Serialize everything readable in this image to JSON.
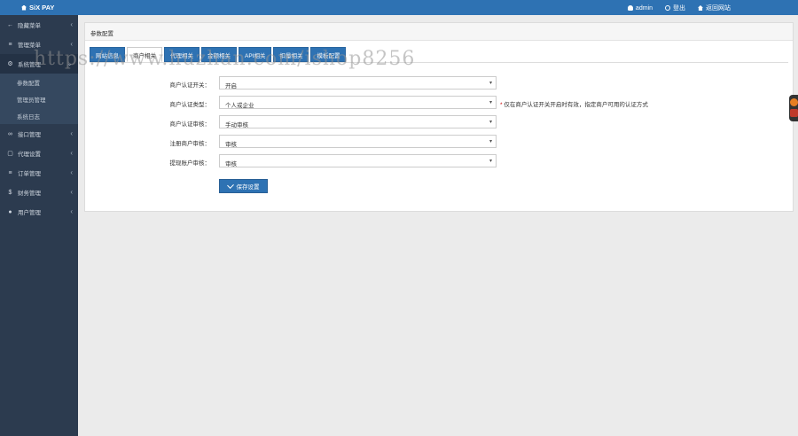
{
  "header": {
    "brand": "SiX PAY",
    "user": "admin",
    "logout": "登出",
    "home": "返回网站"
  },
  "sidebar": {
    "items": [
      {
        "icon": "arrow-left-icon",
        "glyph": "←",
        "label": "隐藏菜单"
      },
      {
        "icon": "list-icon",
        "glyph": "≡",
        "label": "管理菜单"
      },
      {
        "icon": "gear-icon",
        "glyph": "⚙",
        "label": "系统管理"
      }
    ],
    "sub_items": [
      "参数配置",
      "管理员管理",
      "系统日志"
    ],
    "items_bottom": [
      {
        "icon": "link-icon",
        "glyph": "🔗",
        "label": "接口管理"
      },
      {
        "icon": "square-icon",
        "glyph": "▢",
        "label": "代理设置"
      },
      {
        "icon": "list-icon",
        "glyph": "≡",
        "label": "订单管理"
      },
      {
        "icon": "dollar-icon",
        "glyph": "$",
        "label": "财务管理"
      },
      {
        "icon": "user-icon",
        "glyph": "👤",
        "label": "用户管理"
      }
    ]
  },
  "panel": {
    "title": "参数配置",
    "tabs": [
      "网站信息",
      "商户相关",
      "代理相关",
      "金额相关",
      "API相关",
      "扣量相关",
      "模板配置"
    ],
    "active_tab": 1
  },
  "form": {
    "rows": [
      {
        "label": "商户认证开关：",
        "value": "开启",
        "hint": ""
      },
      {
        "label": "商户认证类型：",
        "value": "个人或企业",
        "hint": "仅在商户认证开关开启时有效，指定商户可用的认证方式"
      },
      {
        "label": "商户认证审核：",
        "value": "手动审核",
        "hint": ""
      },
      {
        "label": "注册商户审核：",
        "value": "审核",
        "hint": ""
      },
      {
        "label": "提现账户审核：",
        "value": "审核",
        "hint": ""
      }
    ],
    "save_label": "保存设置"
  },
  "watermark": "https://www.huzhan.com/ishop8256",
  "colors": {
    "accent": "#2e72b3",
    "sidebar": "#2c3b4f"
  }
}
